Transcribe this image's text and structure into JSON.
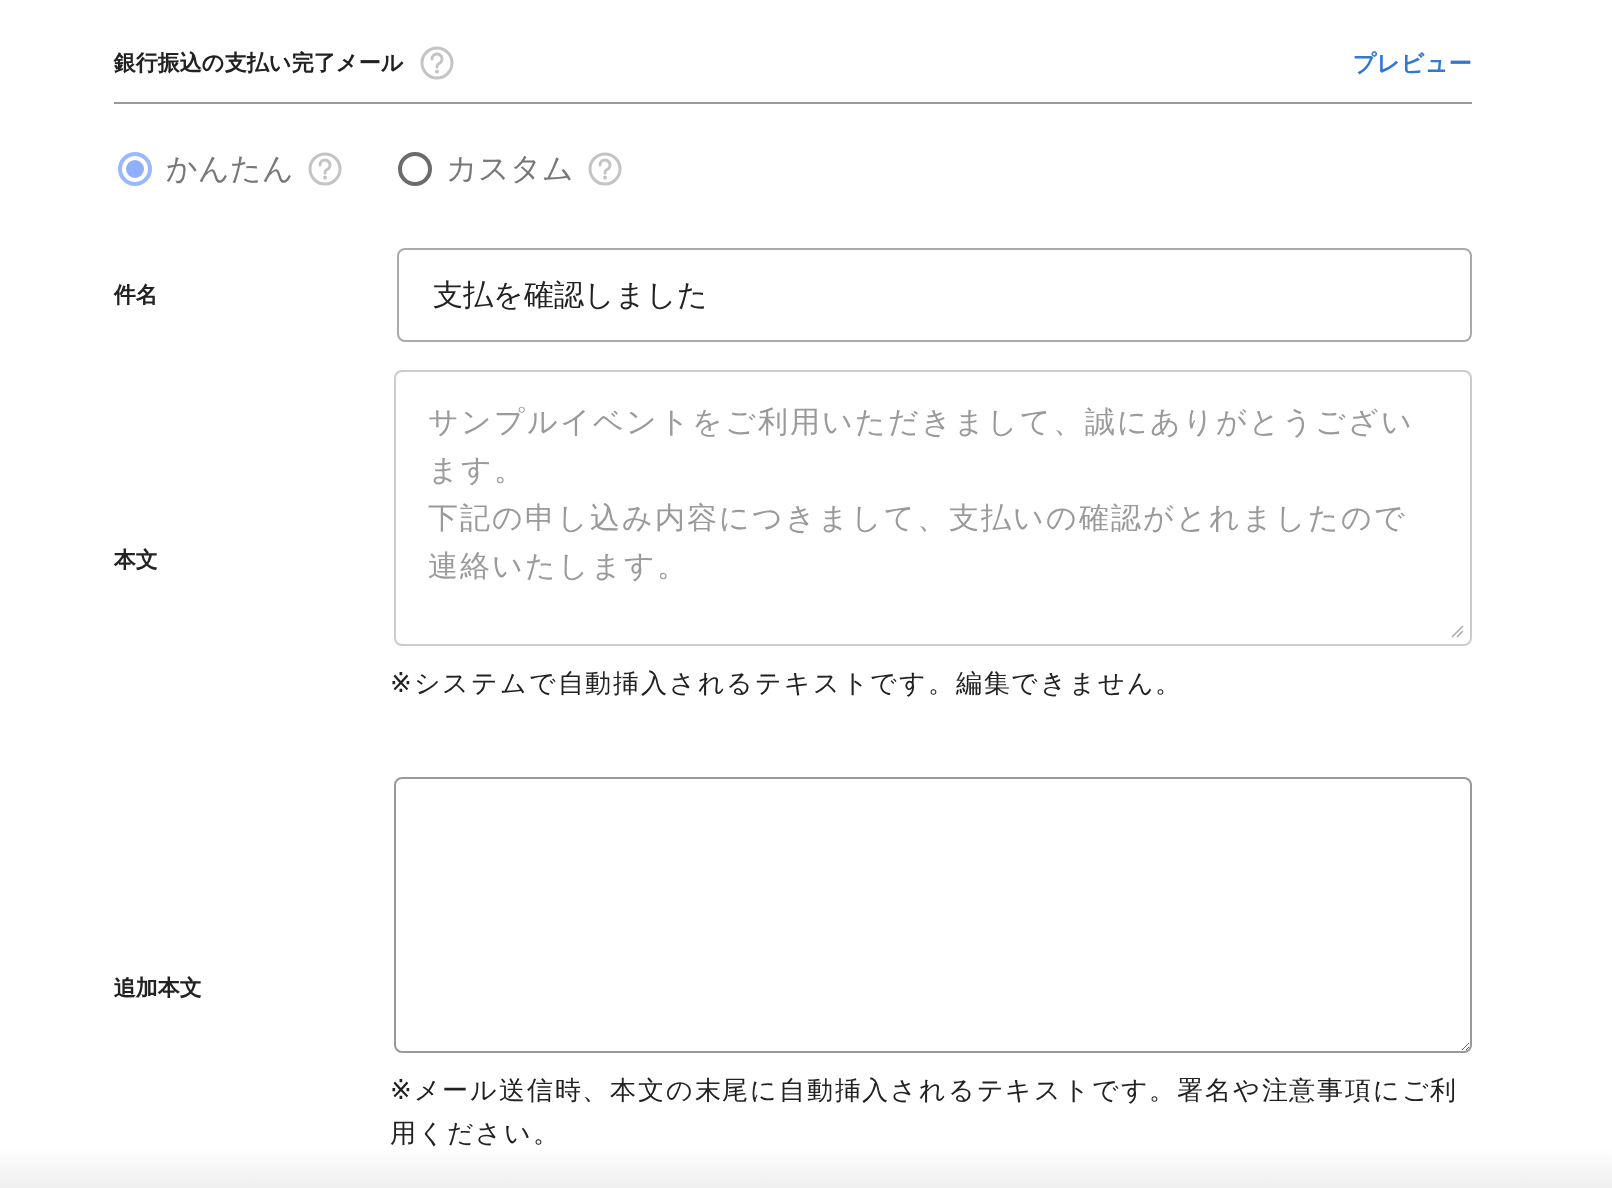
{
  "header": {
    "title": "銀行振込の支払い完了メール",
    "preview_link": "プレビュー"
  },
  "modes": [
    {
      "label": "かんたん",
      "selected": true
    },
    {
      "label": "カスタム",
      "selected": false
    }
  ],
  "fields": [
    {
      "kind": "input",
      "label": "件名",
      "value": "支払を確認しました"
    },
    {
      "kind": "textarea",
      "label": "本文",
      "placeholder": [
        "サンプルイベントをご利用いただきまして、誠にありがとうございます。",
        "下記の申し込み内容につきまして、支払いの確認がとれましたので連絡いたします。"
      ],
      "note": "※システムで自動挿入されるテキストです。編集できません。"
    },
    {
      "kind": "textarea",
      "label": "追加本文",
      "note": "※メール送信時、本文の末尾に自動挿入されるテキストです。署名や注意事項にご利用ください。"
    }
  ]
}
